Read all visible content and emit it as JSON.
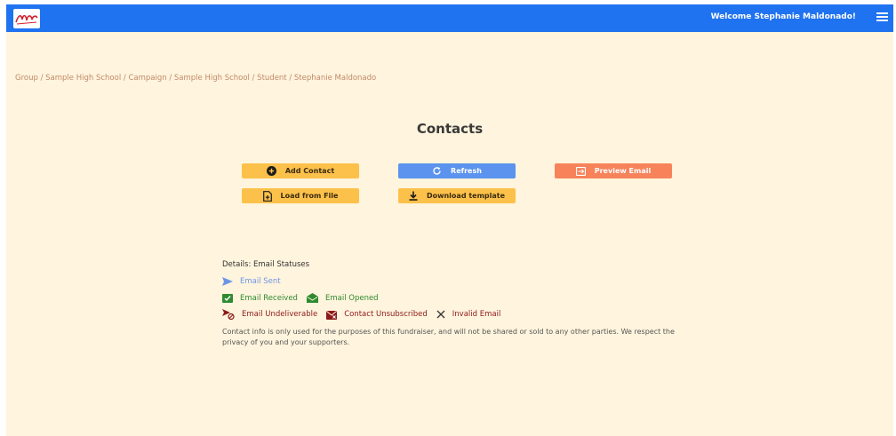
{
  "header": {
    "welcome_text": "Welcome Stephanie Maldonado!",
    "logo_icon": "brand-logo",
    "menu_icon": "hamburger-menu-icon",
    "bar_color": "#1f72f0"
  },
  "breadcrumb": "Group / Sample High School / Campaign / Sample High School / Student / Stephanie Maldonado",
  "page_title": "Contacts",
  "buttons": {
    "add_contact": "Add Contact",
    "refresh": "Refresh",
    "preview_email": "Preview Email",
    "load_from_file": "Load from File",
    "download_template": "Download template"
  },
  "details": {
    "title": "Details: Email Statuses",
    "statuses": [
      {
        "label": "Email Sent",
        "icon": "paper-plane-icon",
        "color": "#6d95e6"
      },
      {
        "label": "Email Received",
        "icon": "envelope-check-icon",
        "color": "#2f8a2f"
      },
      {
        "label": "Email Opened",
        "icon": "envelope-open-icon",
        "color": "#2f8a2f"
      },
      {
        "label": "Email Undeliverable",
        "icon": "plane-blocked-icon",
        "color": "#8b1a1a"
      },
      {
        "label": "Contact Unsubscribed",
        "icon": "envelope-x-icon",
        "color": "#8b1a1a"
      },
      {
        "label": "Invalid Email",
        "icon": "x-icon",
        "color": "#8b1a1a"
      }
    ]
  },
  "privacy_note": "Contact info is only used for the purposes of this fundraiser, and will not be shared or sold to any other parties. We respect the privacy of you and your supporters.",
  "colors": {
    "background": "#fff4dd",
    "yellow_button": "#fcc14a",
    "blue_button": "#5b93ee",
    "orange_button": "#f7835a",
    "breadcrumb": "#c08a6a"
  }
}
